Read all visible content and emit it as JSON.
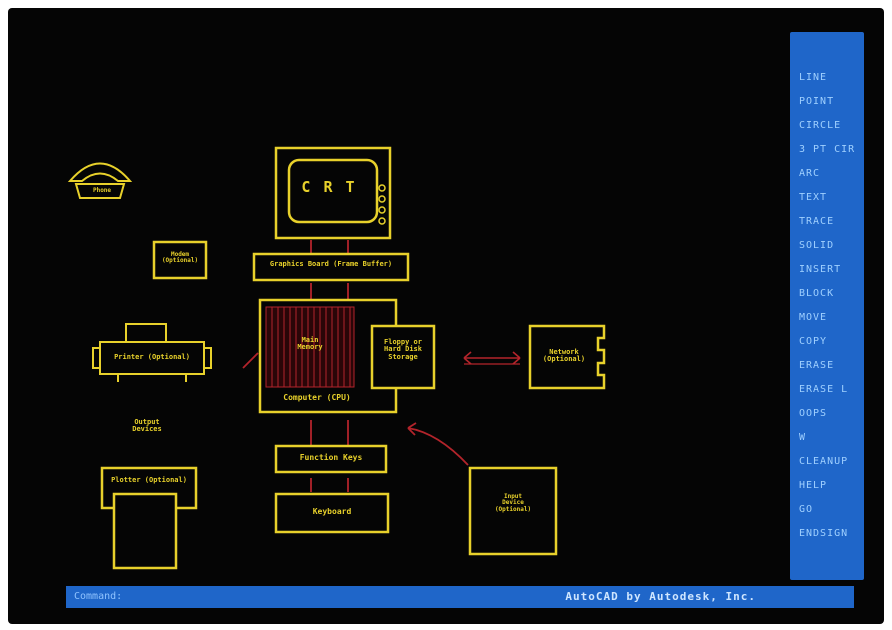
{
  "drawing": {
    "crt_label": "C R T",
    "graphics_board_label": "Graphics Board (Frame Buffer)",
    "computer_label": "Computer (CPU)",
    "memory_label": "Main\nMemory",
    "disk_label": "Floppy or\nHard Disk\nStorage",
    "network_label": "Network\n(Optional)",
    "modem_label": "Modem\n(Optional)",
    "phone_label": "Phone",
    "printer_label": "Printer (Optional)",
    "output_devices_label": "Output\nDevices",
    "plotter_label": "Plotter (Optional)",
    "function_keys_label": "Function Keys",
    "keyboard_label": "Keyboard",
    "input_device_label": "Input\nDevice\n(Optional)"
  },
  "menu": {
    "items": [
      "LINE",
      "POINT",
      "CIRCLE",
      "3 PT CIR",
      "ARC",
      "TEXT",
      "TRACE",
      "SOLID",
      "INSERT",
      "BLOCK",
      "MOVE",
      "COPY",
      "ERASE",
      "ERASE L",
      "OOPS",
      "W",
      "CLEANUP",
      "HELP",
      "GO",
      "ENDSIGN"
    ]
  },
  "status": {
    "command_label": "Command:",
    "command_value": "",
    "credit": "AutoCAD by Autodesk, Inc."
  },
  "colors": {
    "screen_bg": "#050505",
    "drawing_yellow": "#e8d12b",
    "drawing_red": "#b3242b",
    "menu_blue": "#1f66c9",
    "menu_text": "#9fd0ff"
  }
}
